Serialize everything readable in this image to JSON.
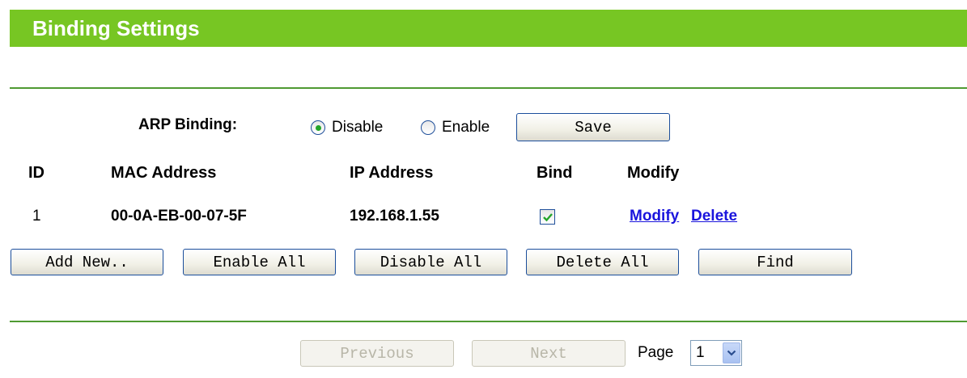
{
  "header": {
    "title": "Binding Settings"
  },
  "arp": {
    "label": "ARP Binding:",
    "options": [
      {
        "label": "Disable",
        "checked": true
      },
      {
        "label": "Enable",
        "checked": false
      }
    ],
    "save_label": "Save"
  },
  "table": {
    "columns": [
      "ID",
      "MAC Address",
      "IP Address",
      "Bind",
      "Modify"
    ],
    "rows": [
      {
        "id": "1",
        "mac": "00-0A-EB-00-07-5F",
        "ip": "192.168.1.55",
        "bind": true,
        "modify_label": "Modify",
        "delete_label": "Delete"
      }
    ]
  },
  "actions": {
    "add_new": "Add New..",
    "enable_all": "Enable All",
    "disable_all": "Disable All",
    "delete_all": "Delete All",
    "find": "Find"
  },
  "pagination": {
    "previous": "Previous",
    "next": "Next",
    "page_label": "Page",
    "page_value": "1"
  },
  "colors": {
    "header_bg": "#77c623",
    "divider": "#4f9a32",
    "link": "#1a14dd",
    "button_border": "#1b4e9b"
  }
}
